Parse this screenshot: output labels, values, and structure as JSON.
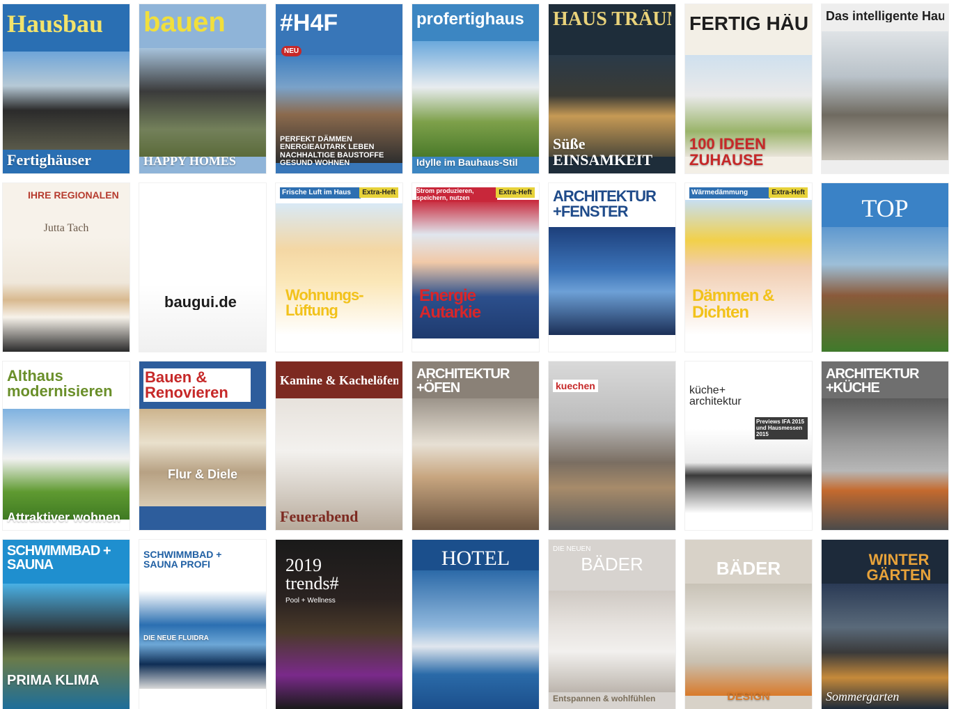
{
  "covers": [
    {
      "title": "Hausbau",
      "subtitle": "",
      "footer": "Fertighäuser",
      "badge": "",
      "bg": "#2a6fb3",
      "fg": "#f3e36b",
      "photo": "linear-gradient(180deg,#6fa5d8 0%,#b6c9d6 35%,#2b2b2b 60%,#5a5a4a 100%)"
    },
    {
      "title": "bauen",
      "subtitle": "",
      "footer": "HAPPY HOMES",
      "badge": "",
      "bg": "#8fb4d8",
      "fg": "#f1df3c",
      "photo": "linear-gradient(180deg,#a7c3dc 0%,#3b3b3b 40%,#73805a 75%,#5b6b3a 100%)"
    },
    {
      "title": "#H4F",
      "subtitle": "",
      "footer": "PERFEKT DÄMMEN ENERGIEAUTARK LEBEN NACHHALTIGE BAUSTOFFE GESUND WOHNEN",
      "badge": "NEU",
      "bg": "#3876b8",
      "fg": "#ffffff",
      "photo": "linear-gradient(180deg,#3f7fc0 0%,#7aa2c9 30%,#8b6a4d 55%,#2e2e2e 100%)"
    },
    {
      "title": "profertighaus",
      "subtitle": "",
      "footer": "Idylle im Bauhaus-Stil",
      "badge": "",
      "bg": "#3c86c2",
      "fg": "#ffffff",
      "photo": "linear-gradient(180deg,#6aa8dc 0%,#e8ecef 40%,#7da04a 70%,#4b7a2a 100%)"
    },
    {
      "title": "HAUS TRÄUME",
      "subtitle": "",
      "footer": "Süße EINSAMKEIT",
      "badge": "",
      "bg": "#1e2d3a",
      "fg": "#e9d27a",
      "photo": "linear-gradient(180deg,#2a3a48 0%,#3b3b35 40%,#c69a55 60%,#4f4a3a 100%)"
    },
    {
      "title": "FERTIG HÄUSER",
      "subtitle": "",
      "footer": "100 IDEEN ZUHAUSE",
      "badge": "",
      "bg": "#f3efe6",
      "fg": "#1e1e1e",
      "ffg": "#c62828",
      "photo": "linear-gradient(180deg,#cfe0ee 0%,#eaeaea 40%,#9ab46a 75%,#e8e3d9 100%)"
    },
    {
      "title": "Das intelligente Haus",
      "subtitle": "",
      "footer": "",
      "badge": "",
      "bg": "#eeeeee",
      "fg": "#1e1e1e",
      "photo": "linear-gradient(180deg,#dfe3e6 0%,#b9c2c9 35%,#6f6a60 65%,#c9c4ba 100%)"
    },
    {
      "title": "IHRE REGIONALEN",
      "subtitle": "Jutta Tach",
      "footer": "",
      "badge": "",
      "bg": "#f7f2ea",
      "fg": "#b63b2e",
      "fg2": "#6b5a4a",
      "photo": "linear-gradient(180deg,#f7f2ea 0%,#efe7da 40%,#d8b98f 55%,#f7f2ea 70%,#2a2a2a 100%)"
    },
    {
      "title": "baugui.de",
      "subtitle": "",
      "footer": "",
      "badge": "",
      "bg": "#ffffff",
      "fg": "#1c1c1c",
      "photo": "linear-gradient(180deg,#ffffff 0%,#ffffff 60%,#f0f0f0 100%)"
    },
    {
      "title": "Wohnungs- Lüftung",
      "subtitle": "Frische Luft im Haus",
      "footer": "",
      "badge": "Extra-Heft",
      "bg": "#ffffff",
      "fg": "#f2c21b",
      "fg2": "#2e6fb1",
      "photo": "linear-gradient(180deg,#d8e9f6 0%,#f4d7a4 35%,#fbe7b8 60%,#ffffff 100%)"
    },
    {
      "title": "Energie Autarkie",
      "subtitle": "Strom produzieren, speichern, nutzen",
      "footer": "",
      "badge": "Extra-Heft",
      "bg": "#ffffff",
      "fg": "#d8262a",
      "fg2": "#ffffff",
      "photo": "linear-gradient(180deg,#c8273a 0%,#e0e6ee 25%,#f1c9a8 45%,#2c4f8c 70%,#1e3a6e 100%)"
    },
    {
      "title": "ARCHITEKTUR +FENSTER",
      "subtitle": "",
      "footer": "",
      "badge": "",
      "bg": "#ffffff",
      "fg": "#1f4b8a",
      "fg2": "#e38b1f",
      "photo": "linear-gradient(180deg,#1d3f7a 0%,#3b73b8 40%,#6da0d6 60%,#1b2f57 100%)"
    },
    {
      "title": "Dämmen & Dichten",
      "subtitle": "Wärmedämmung",
      "footer": "",
      "badge": "Extra-Heft",
      "bg": "#ffffff",
      "fg": "#f2c21b",
      "fg2": "#2e6fb1",
      "photo": "linear-gradient(180deg,#c7dff2 0%,#f2d04a 30%,#f1cdb0 50%,#ffffff 100%)"
    },
    {
      "title": "TOP",
      "subtitle": "",
      "footer": "",
      "badge": "",
      "bg": "#3a82c6",
      "fg": "#ffffff",
      "photo": "linear-gradient(180deg,#5e98cf 0%,#9dbfd8 30%,#8a5a3a 55%,#3f7a2b 100%)"
    },
    {
      "title": "Althaus modernisieren",
      "subtitle": "",
      "footer": "Attraktiver wohnen",
      "badge": "",
      "bg": "#ffffff",
      "fg": "#6a8f2a",
      "fg2": "#b8392c",
      "photo": "linear-gradient(180deg,#7fb2e0 0%,#f1f1f1 45%,#5f9a31 75%,#3f7a22 100%)"
    },
    {
      "title": "Bauen & Renovieren",
      "subtitle": "",
      "footer": "Flur & Diele",
      "badge": "",
      "bg": "#2d5d9c",
      "fg": "#c62828",
      "photo": "linear-gradient(180deg,#cdb48d 0%,#e9e0cc 35%,#b7a183 65%,#d8cbb3 100%)"
    },
    {
      "title": "Kamine & Kachelöfen",
      "subtitle": "",
      "footer": "Feuerabend",
      "badge": "",
      "bg": "#7d2a21",
      "fg": "#ffffff",
      "ffg": "#7d2a21",
      "photo": "linear-gradient(180deg,#e7e2dc 0%,#f3f1ee 40%,#d6cfc6 70%,#b7aa9b 100%)"
    },
    {
      "title": "ARCHITEKTUR +ÖFEN",
      "subtitle": "",
      "footer": "",
      "badge": "",
      "bg": "#8a8177",
      "fg": "#ffffff",
      "photo": "linear-gradient(180deg,#9c948a 0%,#e7e0d4 35%,#c7a57f 60%,#6b5440 100%)"
    },
    {
      "title": "kuechen",
      "subtitle": "",
      "footer": "",
      "badge": "",
      "bg": "#d9d9d9",
      "fg": "#c62828",
      "photo": "linear-gradient(180deg,#d9d9d9 0%,#bdbdbd 35%,#7a6e62 60%,#a78b6a 75%,#5b5b5b 100%)"
    },
    {
      "title": "küche+ architektur",
      "subtitle": "Previews IFA 2015 und Hausmessen 2015",
      "footer": "",
      "badge": "",
      "bg": "#ffffff",
      "fg": "#2a2a2a",
      "fg2": "#ffffff",
      "photo": "linear-gradient(180deg,#ffffff 0%,#e9e9e9 40%,#3a3a3a 55%,#9a9a9a 75%,#ffffff 100%)"
    },
    {
      "title": "ARCHITEKTUR +KÜCHE",
      "subtitle": "",
      "footer": "",
      "badge": "",
      "bg": "#6f6f6f",
      "fg": "#ffffff",
      "photo": "linear-gradient(180deg,#5a5a5a 0%,#9b9b9b 35%,#b7b7b7 55%,#c46a2e 70%,#4a4a4a 100%)"
    },
    {
      "title": "SCHWIMMBAD + SAUNA",
      "subtitle": "",
      "footer": "PRIMA KLIMA",
      "badge": "",
      "bg": "#1f8fcf",
      "fg": "#ffffff",
      "ffg": "#ffffff",
      "photo": "linear-gradient(180deg,#4ab0e4 0%,#2b2b2b 40%,#6a7b4a 60%,#1d6e9a 100%)"
    },
    {
      "title": "SCHWIMMBAD + SAUNA PROFI",
      "subtitle": "",
      "footer": "DIE NEUE FLUIDRA",
      "badge": "",
      "bg": "#ffffff",
      "fg": "#1f5fa3",
      "photo": "linear-gradient(180deg,#ffffff 0%,#2b6fb1 35%,#6da7d6 55%,#0f2e55 75%,#d9d9d9 100%)"
    },
    {
      "title": "2019 trends#",
      "subtitle": "Pool + Wellness",
      "footer": "",
      "badge": "",
      "bg": "#1a1a1a",
      "fg": "#ffffff",
      "photo": "linear-gradient(180deg,#1a1a1a 0%,#2a2220 35%,#4a3a2a 55%,#7a2a8a 80%,#1a1a1a 100%)"
    },
    {
      "title": "HOTEL",
      "subtitle": "",
      "footer": "",
      "badge": "",
      "bg": "#1b4f8c",
      "fg": "#ffffff",
      "photo": "linear-gradient(180deg,#2c6aa8 0%,#8fb7dc 40%,#e0e6ee 55%,#2a6aa8 75%,#1b4f8c 100%)"
    },
    {
      "title": "BÄDER",
      "subtitle": "DIE NEUEN",
      "footer": "Entspannen & wohlfühlen",
      "badge": "",
      "bg": "#d7d3cf",
      "fg": "#ffffff",
      "photo": "linear-gradient(180deg,#cfc9c3 0%,#e7e3df 35%,#f2f0ee 60%,#bcb5ad 100%)"
    },
    {
      "title": "BÄDER",
      "subtitle": "",
      "footer": "DESIGN",
      "badge": "",
      "bg": "#d8d2c8",
      "fg": "#ffffff",
      "photo": "linear-gradient(180deg,#c8c2b6 0%,#eae7e1 40%,#c9c0b0 70%,#d87a2a 100%)"
    },
    {
      "title": "WINTER GÄRTEN",
      "subtitle": "",
      "footer": "Sommergarten",
      "badge": "",
      "bg": "#1d2a3a",
      "fg": "#e7a23a",
      "photo": "linear-gradient(180deg,#2a3a55 0%,#5a6a7a 35%,#3a3a3a 55%,#c68a3a 75%,#1d2a3a 100%)"
    }
  ]
}
